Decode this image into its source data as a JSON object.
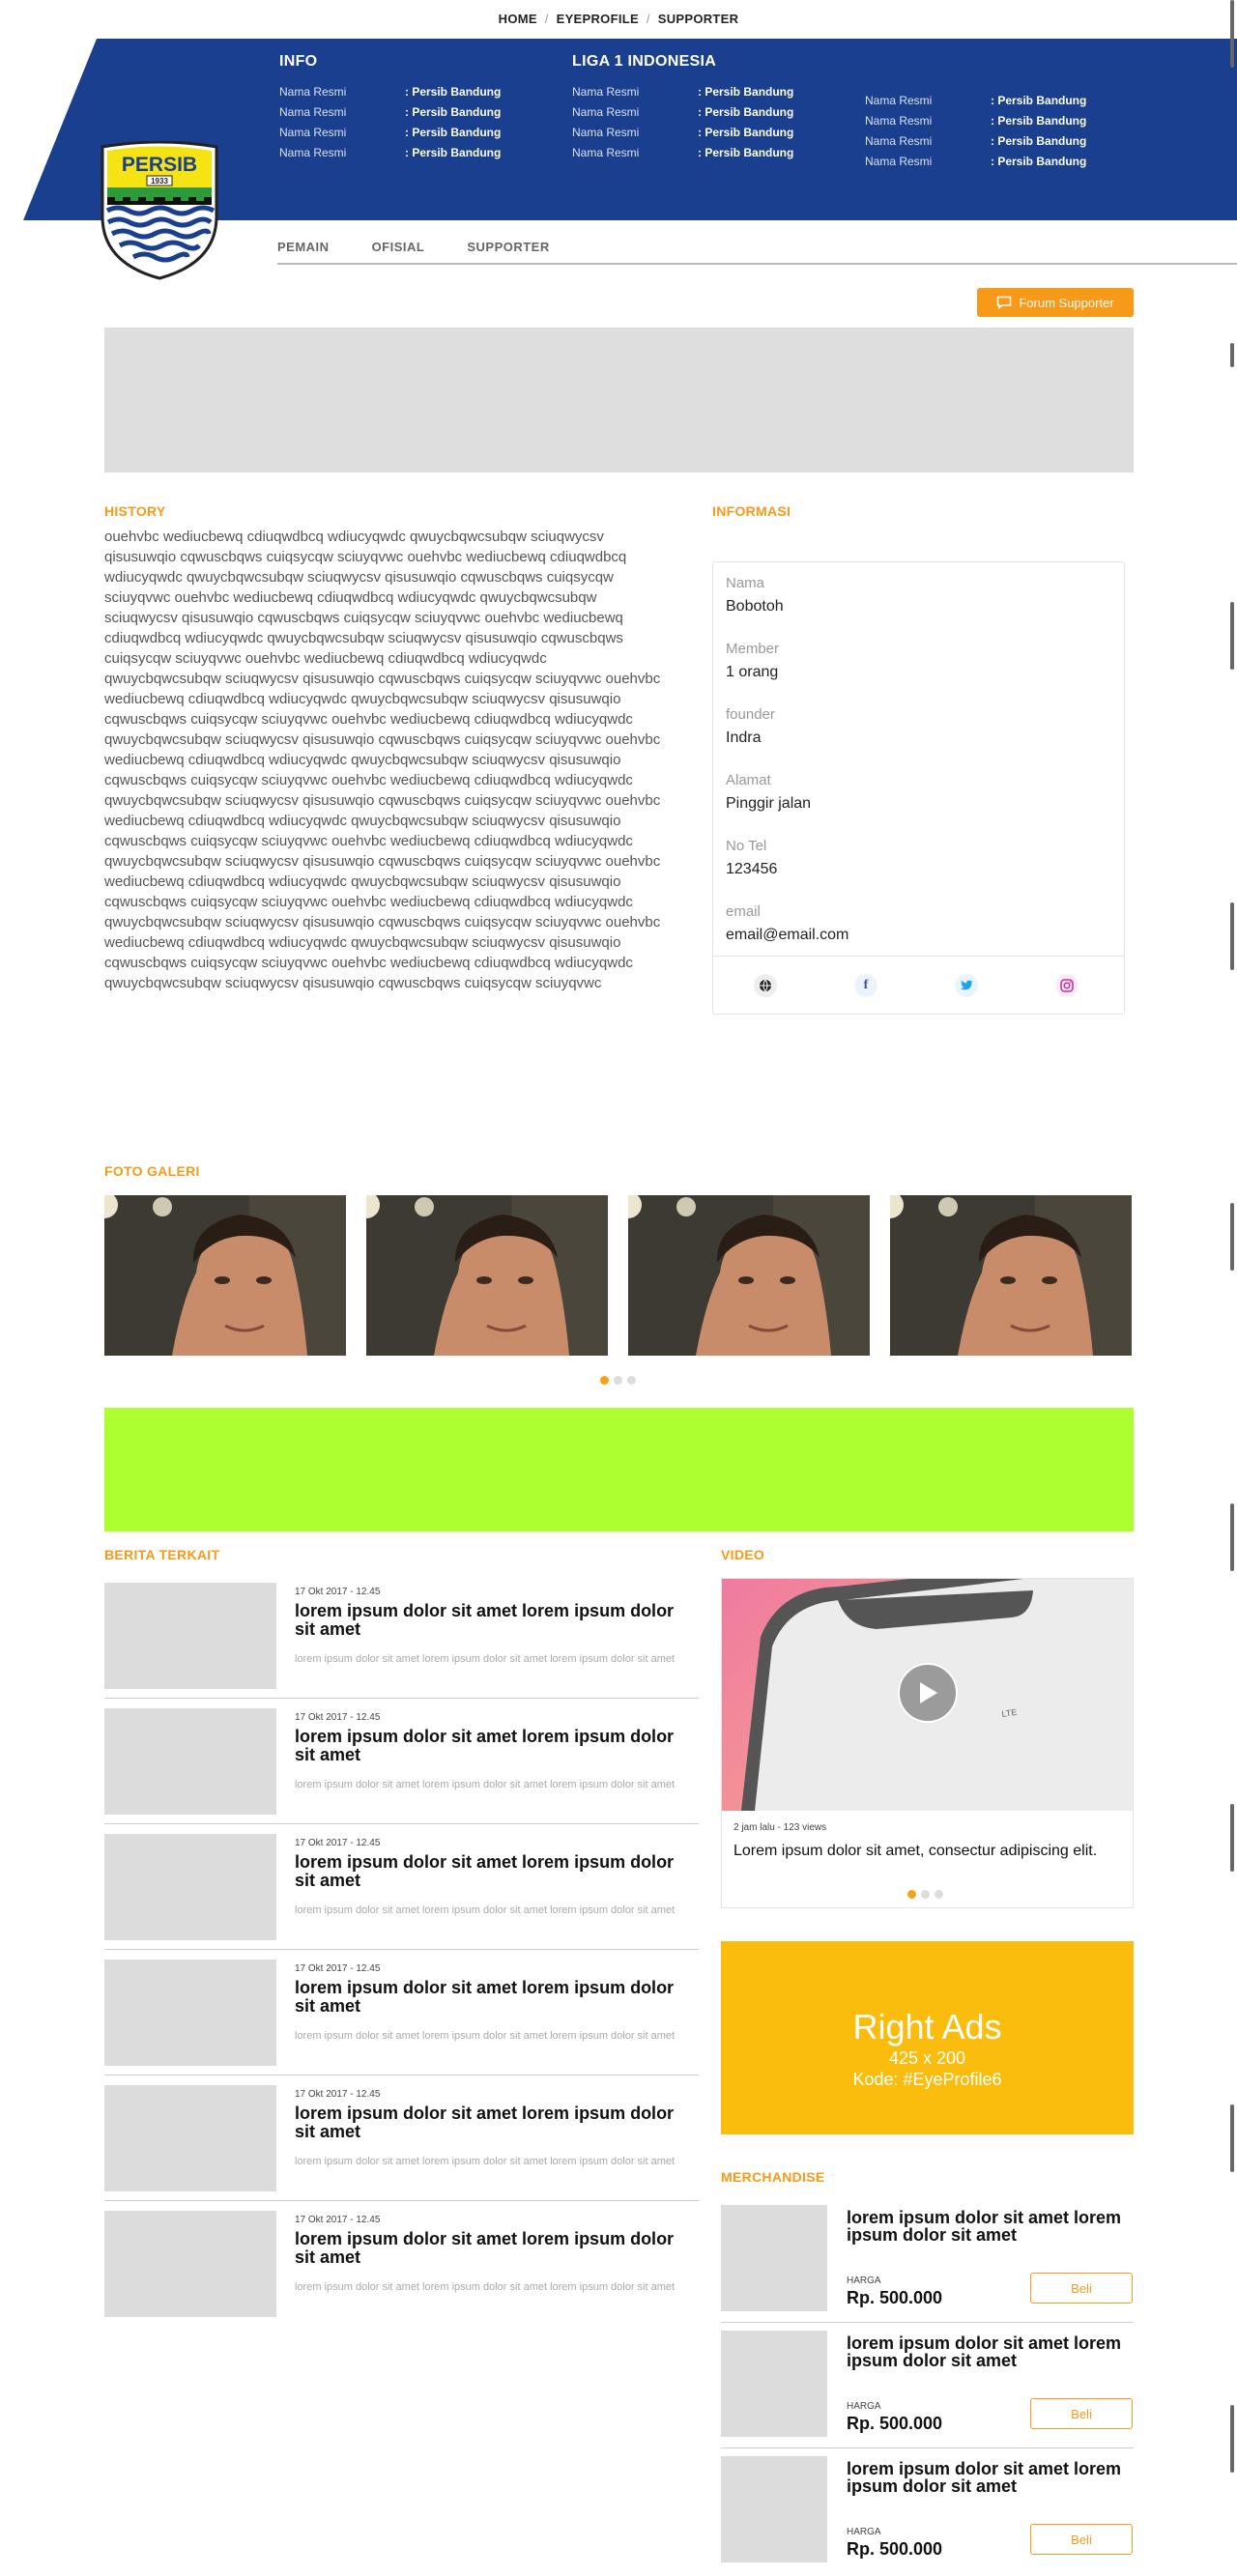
{
  "topnav": {
    "home": "HOME",
    "eyeprofile": "EYEPROFILE",
    "supporter": "SUPPORTER",
    "separator": "/"
  },
  "header": {
    "info_title": "INFO",
    "league_title": "LIGA 1 INDONESIA",
    "rows_label": "Nama Resmi",
    "rows_value": ": Persib Bandung",
    "logo_text": "PERSIB",
    "logo_year": "1933"
  },
  "tabs": [
    "PEMAIN",
    "OFISIAL",
    "SUPPORTER"
  ],
  "forum_button": "Forum Supporter",
  "history": {
    "title": "HISTORY",
    "text": "ouehvbc wediucbewq cdiuqwdbcq wdiucyqwdc qwuycbqwcsubqw sciuqwycsv qisusuwqio cqwuscbqws cuiqsycqw sciuyqvwc ouehvbc wediucbewq cdiuqwdbcq wdiucyqwdc qwuycbqwcsubqw sciuqwycsv qisusuwqio cqwuscbqws cuiqsycqw sciuyqvwc ouehvbc wediucbewq cdiuqwdbcq wdiucyqwdc qwuycbqwcsubqw sciuqwycsv qisusuwqio cqwuscbqws cuiqsycqw sciuyqvwc ouehvbc wediucbewq cdiuqwdbcq wdiucyqwdc qwuycbqwcsubqw sciuqwycsv qisusuwqio cqwuscbqws cuiqsycqw sciuyqvwc ouehvbc wediucbewq cdiuqwdbcq wdiucyqwdc qwuycbqwcsubqw sciuqwycsv qisusuwqio cqwuscbqws cuiqsycqw sciuyqvwc ouehvbc wediucbewq cdiuqwdbcq wdiucyqwdc qwuycbqwcsubqw sciuqwycsv qisusuwqio cqwuscbqws cuiqsycqw sciuyqvwc ouehvbc wediucbewq cdiuqwdbcq wdiucyqwdc qwuycbqwcsubqw sciuqwycsv qisusuwqio cqwuscbqws cuiqsycqw sciuyqvwc ouehvbc wediucbewq cdiuqwdbcq wdiucyqwdc qwuycbqwcsubqw sciuqwycsv qisusuwqio cqwuscbqws cuiqsycqw sciuyqvwc ouehvbc wediucbewq cdiuqwdbcq wdiucyqwdc qwuycbqwcsubqw sciuqwycsv qisusuwqio cqwuscbqws cuiqsycqw sciuyqvwc ouehvbc wediucbewq cdiuqwdbcq wdiucyqwdc qwuycbqwcsubqw sciuqwycsv qisusuwqio cqwuscbqws cuiqsycqw sciuyqvwc ouehvbc wediucbewq cdiuqwdbcq wdiucyqwdc qwuycbqwcsubqw sciuqwycsv qisusuwqio cqwuscbqws cuiqsycqw sciuyqvwc ouehvbc wediucbewq cdiuqwdbcq wdiucyqwdc qwuycbqwcsubqw sciuqwycsv qisusuwqio cqwuscbqws cuiqsycqw sciuyqvwc ouehvbc wediucbewq cdiuqwdbcq wdiucyqwdc qwuycbqwcsubqw sciuqwycsv qisusuwqio cqwuscbqws cuiqsycqw sciuyqvwc ouehvbc wediucbewq cdiuqwdbcq wdiucyqwdc qwuycbqwcsubqw sciuqwycsv qisusuwqio cqwuscbqws cuiqsycqw sciuyqvwc ouehvbc wediucbewq cdiuqwdbcq wdiucyqwdc qwuycbqwcsubqw sciuqwycsv qisusuwqio cqwuscbqws cuiqsycqw sciuyqvwc"
  },
  "informasi": {
    "title": "INFORMASI",
    "fields": [
      {
        "label": "Nama",
        "value": "Bobotoh"
      },
      {
        "label": "Member",
        "value": "1 orang"
      },
      {
        "label": "founder",
        "value": "Indra"
      },
      {
        "label": "Alamat",
        "value": "Pinggir jalan"
      },
      {
        "label": "No Tel",
        "value": "123456"
      },
      {
        "label": "email",
        "value": "email@email.com"
      }
    ]
  },
  "gallery": {
    "title": "FOTO GALERI"
  },
  "berita": {
    "title": "BERITA TERKAIT",
    "items": [
      {
        "date": "17 Okt 2017 - 12.45",
        "title": "lorem ipsum dolor sit amet lorem ipsum dolor sit amet",
        "desc": "lorem ipsum dolor sit amet lorem ipsum dolor sit amet lorem ipsum dolor sit amet"
      },
      {
        "date": "17 Okt 2017 - 12.45",
        "title": "lorem ipsum dolor sit amet lorem ipsum dolor sit amet",
        "desc": "lorem ipsum dolor sit amet lorem ipsum dolor sit amet lorem ipsum dolor sit amet"
      },
      {
        "date": "17 Okt 2017 - 12.45",
        "title": "lorem ipsum dolor sit amet lorem ipsum dolor sit amet",
        "desc": "lorem ipsum dolor sit amet lorem ipsum dolor sit amet lorem ipsum dolor sit amet"
      },
      {
        "date": "17 Okt 2017 - 12.45",
        "title": "lorem ipsum dolor sit amet lorem ipsum dolor sit amet",
        "desc": "lorem ipsum dolor sit amet lorem ipsum dolor sit amet lorem ipsum dolor sit amet"
      },
      {
        "date": "17 Okt 2017 - 12.45",
        "title": "lorem ipsum dolor sit amet lorem ipsum dolor sit amet",
        "desc": "lorem ipsum dolor sit amet lorem ipsum dolor sit amet lorem ipsum dolor sit amet"
      },
      {
        "date": "17 Okt 2017 - 12.45",
        "title": "lorem ipsum dolor sit amet lorem ipsum dolor sit amet",
        "desc": "lorem ipsum dolor sit amet lorem ipsum dolor sit amet lorem ipsum dolor sit amet"
      }
    ]
  },
  "video": {
    "title": "VIDEO",
    "meta": "2 jam lalu - 123 views",
    "caption": "Lorem ipsum dolor sit amet, consectur adipiscing elit.",
    "phone_status": "LTE"
  },
  "right_ad": {
    "title": "Right Ads",
    "size": "425 x 200",
    "code": "Kode: #EyeProfile6"
  },
  "merchandise": {
    "title": "MERCHANDISE",
    "items": [
      {
        "title": "lorem ipsum dolor sit amet lorem ipsum dolor sit amet",
        "harga_label": "HARGA",
        "price": "Rp. 500.000",
        "button": "Beli"
      },
      {
        "title": "lorem ipsum dolor sit amet lorem ipsum dolor sit amet",
        "harga_label": "HARGA",
        "price": "Rp. 500.000",
        "button": "Beli"
      },
      {
        "title": "lorem ipsum dolor sit amet lorem ipsum dolor sit amet",
        "harga_label": "HARGA",
        "price": "Rp. 500.000",
        "button": "Beli"
      }
    ]
  },
  "colors": {
    "brand_blue": "#1a3f8f",
    "accent_orange": "#f79a1a",
    "ad_green": "#adff2f",
    "ad_yellow": "#fbbd0d"
  }
}
